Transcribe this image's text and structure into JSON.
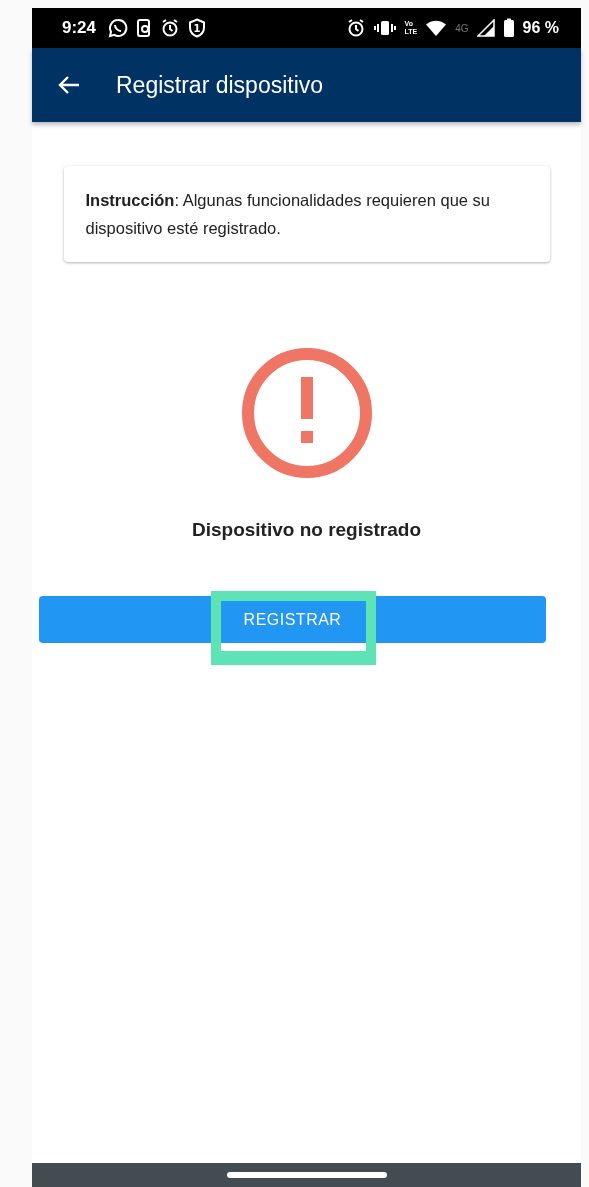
{
  "status_bar": {
    "time": "9:24",
    "shield_number": "1",
    "volte": [
      "Vo",
      "LTE"
    ],
    "network": "4G",
    "battery": "96 %"
  },
  "app_bar": {
    "title": "Registrar dispositivo"
  },
  "instruction_card": {
    "text": "**Instrucción**: Algunas funcionalidades requieren que su dispositivo esté registrado."
  },
  "status": {
    "message": "Dispositivo no registrado"
  },
  "button": {
    "label": "REGISTRAR",
    "highlighted": true
  }
}
